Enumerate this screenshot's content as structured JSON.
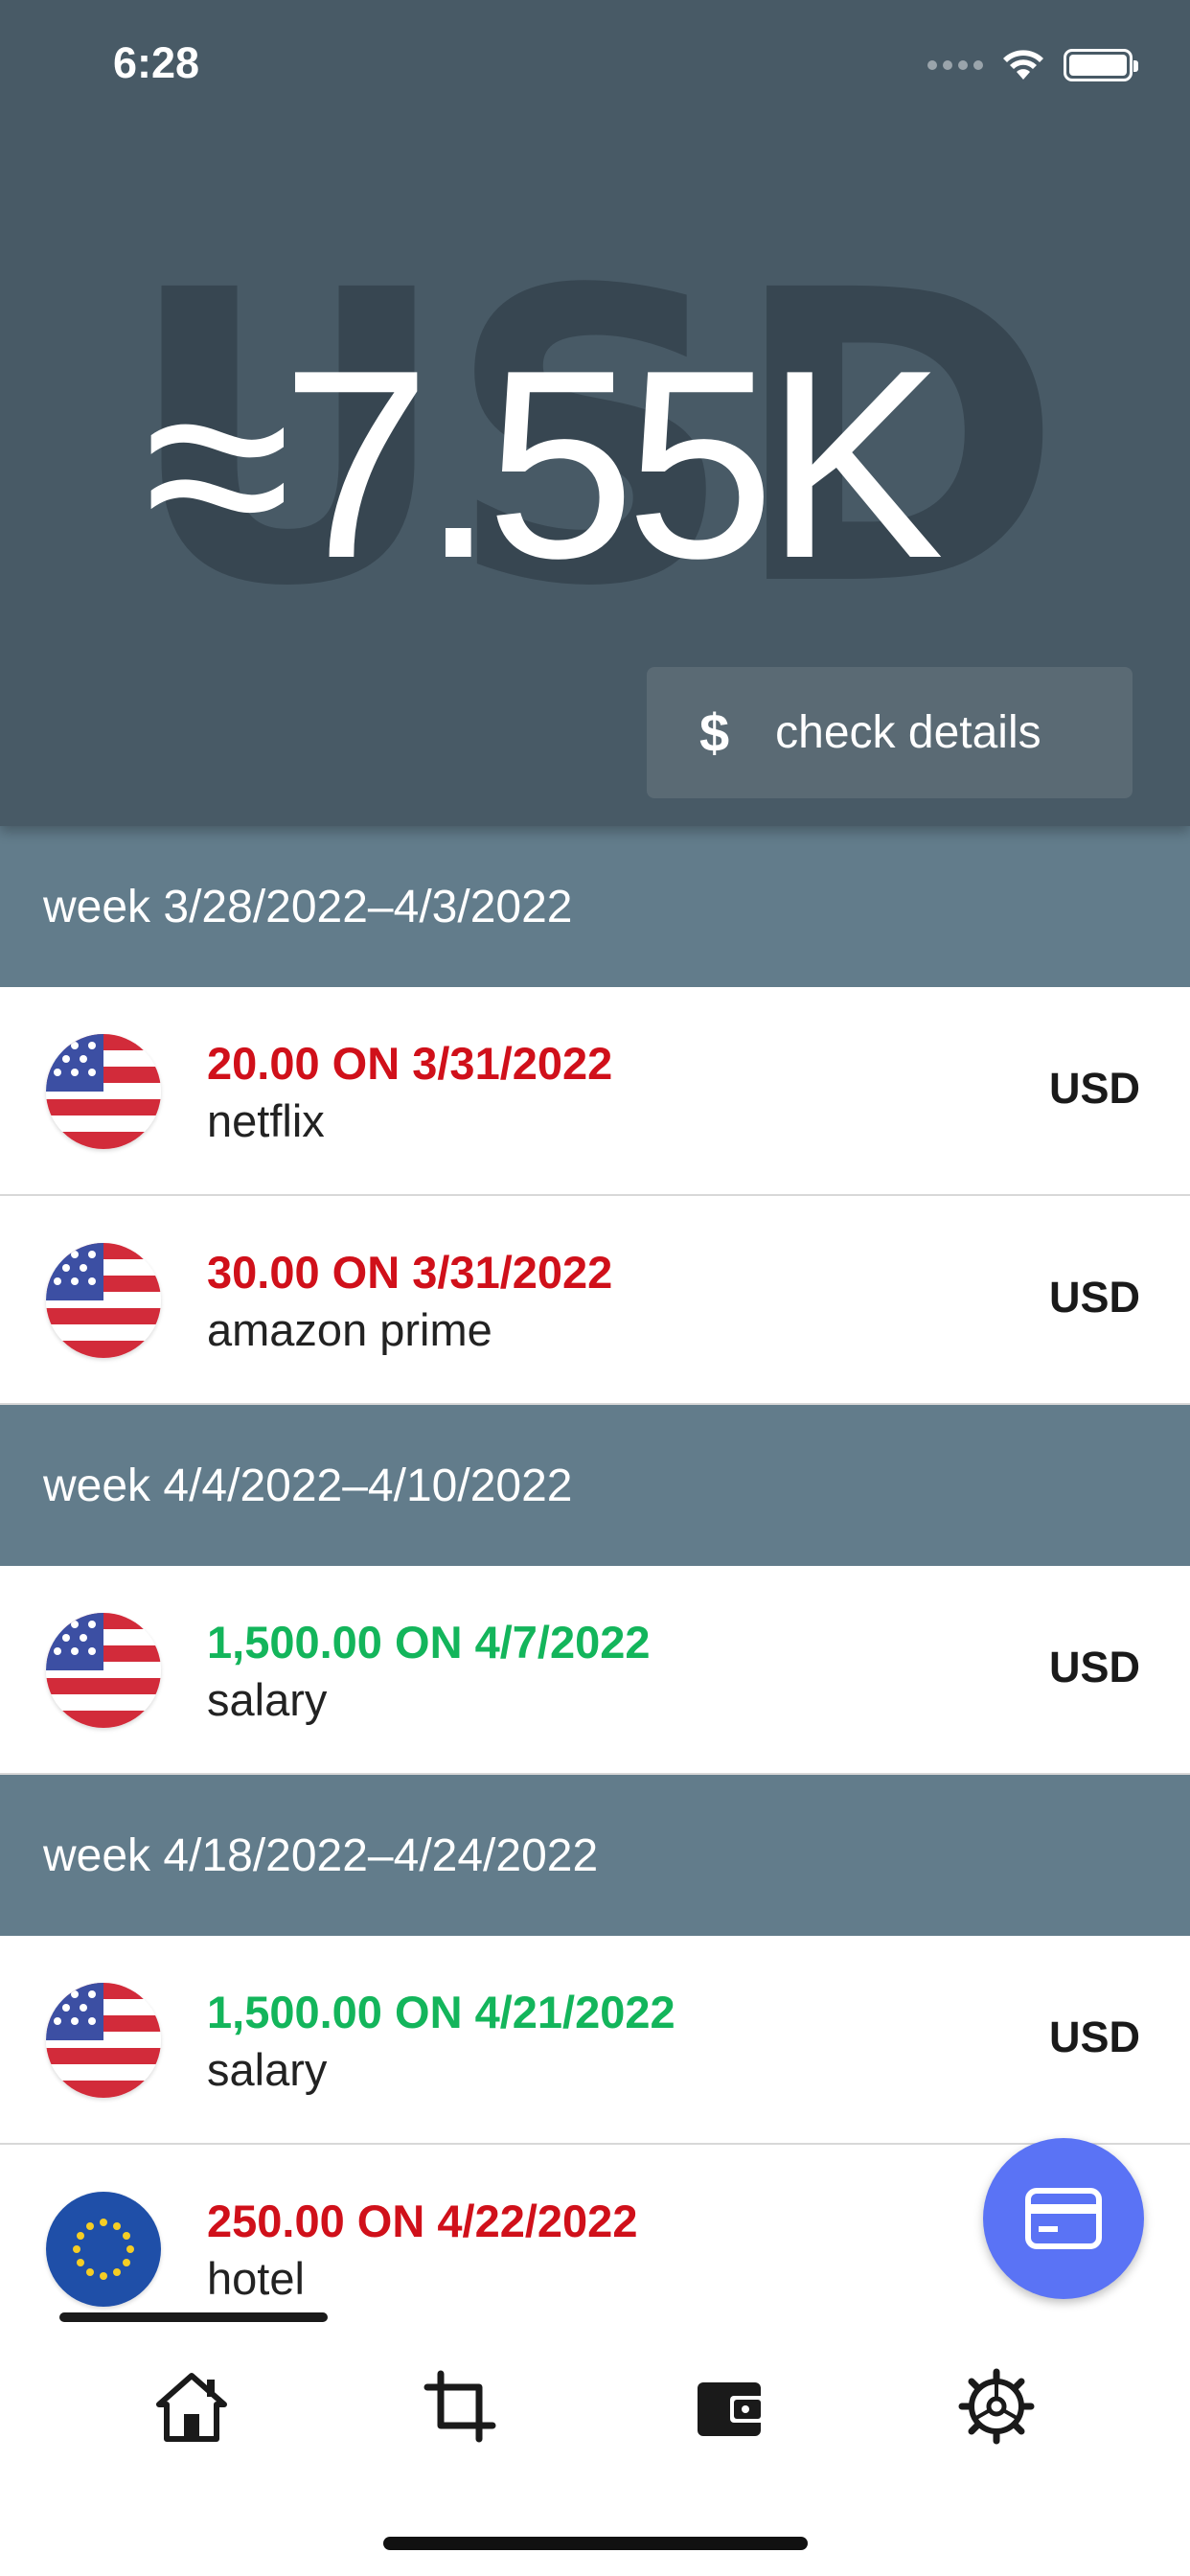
{
  "status_bar": {
    "time": "6:28"
  },
  "header": {
    "background_code": "USD",
    "total": "≈7.55K",
    "details_button": {
      "icon": "dollar-icon",
      "symbol": "$",
      "label": "check details"
    }
  },
  "weeks": [
    {
      "label": "week 3/28/2022–4/3/2022",
      "transactions": [
        {
          "amount_line": "20.00 ON 3/31/2022",
          "description": "netflix",
          "currency": "USD",
          "flag": "us-flag-icon",
          "type": "expense"
        },
        {
          "amount_line": "30.00 ON 3/31/2022",
          "description": "amazon prime",
          "currency": "USD",
          "flag": "us-flag-icon",
          "type": "expense"
        }
      ]
    },
    {
      "label": "week 4/4/2022–4/10/2022",
      "transactions": [
        {
          "amount_line": "1,500.00 ON 4/7/2022",
          "description": "salary",
          "currency": "USD",
          "flag": "us-flag-icon",
          "type": "income"
        }
      ]
    },
    {
      "label": "week 4/18/2022–4/24/2022",
      "transactions": [
        {
          "amount_line": "1,500.00 ON 4/21/2022",
          "description": "salary",
          "currency": "USD",
          "flag": "us-flag-icon",
          "type": "income"
        },
        {
          "amount_line": "250.00 ON 4/22/2022",
          "description": "hotel",
          "currency": "",
          "flag": "eu-flag-icon",
          "type": "expense"
        }
      ]
    }
  ],
  "fab": {
    "icon": "credit-card-icon"
  },
  "tab_bar": {
    "items": [
      {
        "icon": "home-icon"
      },
      {
        "icon": "crop-icon"
      },
      {
        "icon": "wallet-icon"
      },
      {
        "icon": "settings-gear-icon"
      }
    ]
  },
  "colors": {
    "header_bg": "#485a66",
    "week_bg": "#627c8b",
    "expense": "#d0101a",
    "income": "#13b55b",
    "fab": "#5a73f5"
  }
}
